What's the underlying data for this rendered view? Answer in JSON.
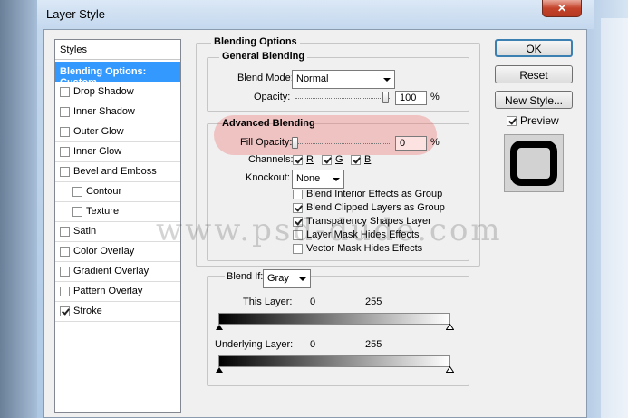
{
  "window": {
    "title": "Layer Style",
    "close_glyph": "✕"
  },
  "styles_panel": {
    "header": "Styles",
    "selected": "Blending Options: Custom",
    "items": [
      {
        "label": "Drop Shadow",
        "checked": false,
        "indent": false
      },
      {
        "label": "Inner Shadow",
        "checked": false,
        "indent": false
      },
      {
        "label": "Outer Glow",
        "checked": false,
        "indent": false
      },
      {
        "label": "Inner Glow",
        "checked": false,
        "indent": false
      },
      {
        "label": "Bevel and Emboss",
        "checked": false,
        "indent": false
      },
      {
        "label": "Contour",
        "checked": false,
        "indent": true
      },
      {
        "label": "Texture",
        "checked": false,
        "indent": true
      },
      {
        "label": "Satin",
        "checked": false,
        "indent": false
      },
      {
        "label": "Color Overlay",
        "checked": false,
        "indent": false
      },
      {
        "label": "Gradient Overlay",
        "checked": false,
        "indent": false
      },
      {
        "label": "Pattern Overlay",
        "checked": false,
        "indent": false
      },
      {
        "label": "Stroke",
        "checked": true,
        "indent": false
      }
    ]
  },
  "blending_options": {
    "title": "Blending Options",
    "general": {
      "title": "General Blending",
      "blend_mode_label": "Blend Mode:",
      "blend_mode_value": "Normal",
      "opacity_label": "Opacity:",
      "opacity_value": "100",
      "opacity_unit": "%",
      "opacity_level": 1.0
    },
    "advanced": {
      "title": "Advanced Blending",
      "fill_opacity_label": "Fill Opacity:",
      "fill_opacity_value": "0",
      "fill_opacity_unit": "%",
      "fill_opacity_level": 0.0,
      "channels_label": "Channels:",
      "channels": [
        {
          "label": "R",
          "checked": true
        },
        {
          "label": "G",
          "checked": true
        },
        {
          "label": "B",
          "checked": true
        }
      ],
      "knockout_label": "Knockout:",
      "knockout_value": "None",
      "options": [
        {
          "label": "Blend Interior Effects as Group",
          "checked": false
        },
        {
          "label": "Blend Clipped Layers as Group",
          "checked": true
        },
        {
          "label": "Transparency Shapes Layer",
          "checked": true
        },
        {
          "label": "Layer Mask Hides Effects",
          "checked": false
        },
        {
          "label": "Vector Mask Hides Effects",
          "checked": false
        }
      ]
    },
    "blend_if": {
      "label": "Blend If:",
      "value": "Gray",
      "this_layer_label": "This Layer:",
      "this_layer_min": "0",
      "this_layer_max": "255",
      "underlying_label": "Underlying Layer:",
      "underlying_min": "0",
      "underlying_max": "255"
    }
  },
  "buttons": {
    "ok": "OK",
    "reset": "Reset",
    "new_style": "New Style...",
    "preview_label": "Preview",
    "preview_checked": true
  },
  "watermark": "www.psd-dude.com",
  "colors": {
    "selection": "#3399ff",
    "highlight": "#f07878",
    "close_button": "#c4432b"
  }
}
